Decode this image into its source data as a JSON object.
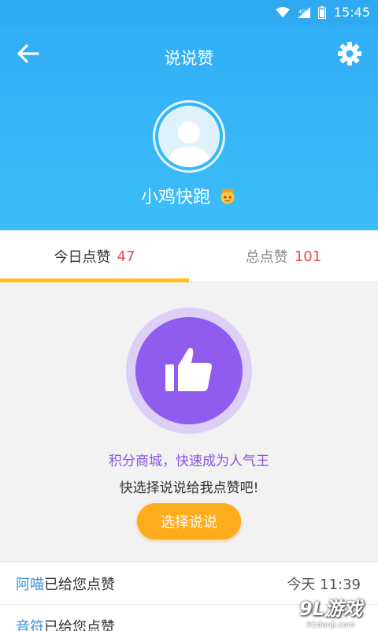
{
  "status_bar": {
    "time": "15:45"
  },
  "header": {
    "title": "说说赞",
    "username": "小鸡快跑",
    "back_icon": "arrow-left-icon",
    "settings_icon": "gear-icon"
  },
  "tabs": [
    {
      "label": "今日点赞",
      "count": "47"
    },
    {
      "label": "总点赞",
      "count": "101"
    }
  ],
  "main": {
    "promo": "积分商城，快速成为人气王",
    "hint": "快选择说说给我点赞吧!",
    "button_label": "选择说说"
  },
  "list": [
    {
      "user": "阿喵",
      "text": "已给您点赞",
      "time": "今天  11:39"
    },
    {
      "user": "音符",
      "text": "已给您点赞",
      "time": ""
    }
  ],
  "watermark": {
    "main": "9L游戏",
    "sub": "91danji.com"
  },
  "colors": {
    "header": "#31aef6",
    "accent_yellow": "#ffc21a",
    "button": "#ffac1c",
    "like_purple": "#8f5cee",
    "promo_purple": "#8a56e0",
    "count_red": "#e84a4a"
  }
}
